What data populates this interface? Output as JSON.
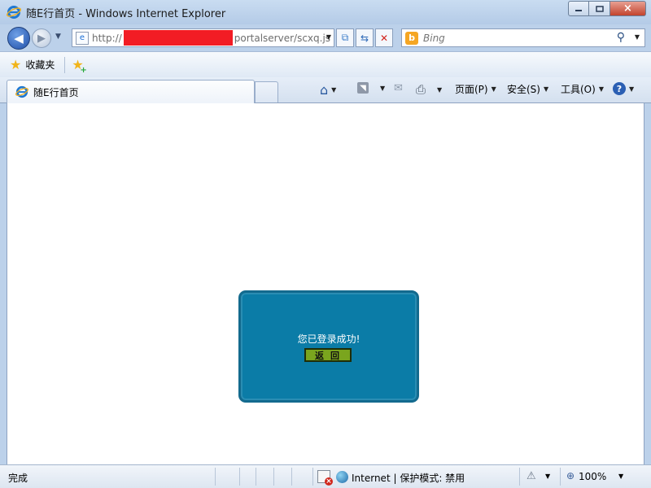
{
  "window": {
    "title": "随E行首页 - Windows Internet Explorer",
    "close_glyph": "×"
  },
  "address": {
    "url_prefix": "http://",
    "url_suffix": "portalserver/scxq.js"
  },
  "search": {
    "placeholder": "Bing"
  },
  "favorites": {
    "label": "收藏夹"
  },
  "tab": {
    "label": "随E行首页"
  },
  "commands": {
    "page": "页面(P)",
    "safety": "安全(S)",
    "tools": "工具(O)"
  },
  "dialog": {
    "message": "您已登录成功!",
    "button": "返回"
  },
  "status": {
    "text": "完成",
    "zone": "Internet | 保护模式: 禁用",
    "zoom": "100%"
  },
  "colors": {
    "dialog_bg": "#0b7ca7",
    "button_bg": "#7aa51e",
    "redaction": "#f21c24"
  }
}
